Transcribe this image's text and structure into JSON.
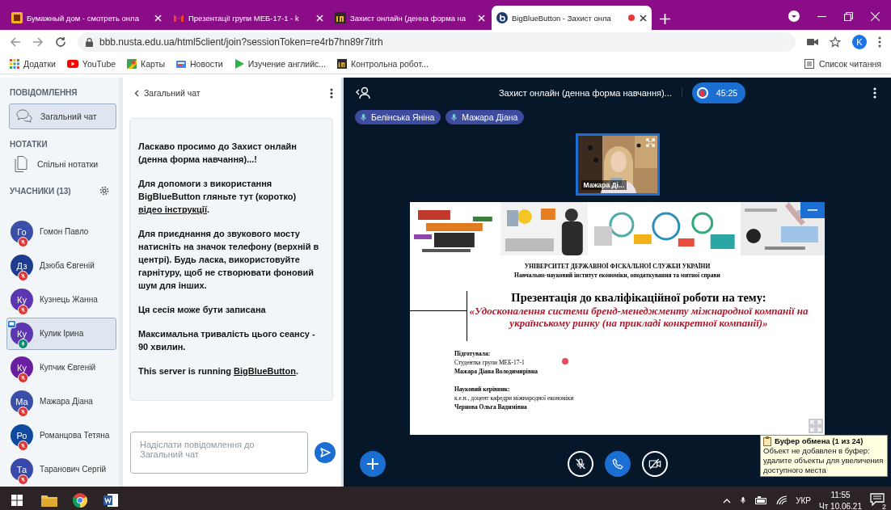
{
  "browser": {
    "tabs": [
      {
        "kind": "book",
        "title": "Бумажный дом - смотреть онла",
        "selected": false,
        "recording": false
      },
      {
        "kind": "mail",
        "title": "Презентації групи МЕБ-17-1 - k",
        "selected": false,
        "recording": false
      },
      {
        "kind": "in",
        "title": "Захист онлайн (денна форма на",
        "selected": false,
        "recording": false
      },
      {
        "kind": "bbb",
        "title": "BigBlueButton - Захист онла",
        "selected": true,
        "recording": true
      }
    ],
    "address": "bbb.nusta.edu.ua/html5client/join?sessionToken=re4rb7hn89r7itrh",
    "profile": "K",
    "bookmarks": [
      {
        "kind": "apps",
        "label": "Додатки"
      },
      {
        "kind": "youtube",
        "label": "YouTube"
      },
      {
        "kind": "maps",
        "label": "Карты"
      },
      {
        "kind": "news",
        "label": "Новости"
      },
      {
        "kind": "play",
        "label": "Изучение английс..."
      },
      {
        "kind": "in",
        "label": "Контрольна робот..."
      }
    ],
    "reading_list": "Список читання"
  },
  "sidebar": {
    "messages_heading": "ПОВІДОМЛЕННЯ",
    "chats": [
      {
        "label": "Загальний чат",
        "selected": true
      }
    ],
    "notes_heading": "НОТАТКИ",
    "notes": [
      {
        "label": "Спільні нотатки"
      }
    ],
    "participants_heading": "УЧАСНИКИ (13)",
    "participants": [
      {
        "initials": "Го",
        "name": "Гомон Павло",
        "color": "#3c4fa8",
        "muted": true,
        "presenter": false,
        "selected": false
      },
      {
        "initials": "Дз",
        "name": "Дзюба Євгеній",
        "color": "#1d3c8f",
        "muted": true,
        "presenter": false,
        "selected": false
      },
      {
        "initials": "Ку",
        "name": "Кузнець Жанна",
        "color": "#5b36b0",
        "muted": true,
        "presenter": false,
        "selected": false
      },
      {
        "initials": "Ку",
        "name": "Кулик Ірина",
        "color": "#5b36b0",
        "muted": false,
        "presenter": true,
        "selected": true
      },
      {
        "initials": "Ку",
        "name": "Купчик Євгеній",
        "color": "#6a1fa0",
        "muted": true,
        "presenter": false,
        "selected": false
      },
      {
        "initials": "Ма",
        "name": "Мажара Діана",
        "color": "#3c4fa8",
        "muted": true,
        "presenter": false,
        "selected": false
      },
      {
        "initials": "Ро",
        "name": "Романцова Тетяна",
        "color": "#0f4a9e",
        "muted": true,
        "presenter": false,
        "selected": false
      },
      {
        "initials": "Та",
        "name": "Таранович Сергій",
        "color": "#3949ab",
        "muted": true,
        "presenter": false,
        "selected": false
      }
    ]
  },
  "chat": {
    "title": "Загальний чат",
    "messages": [
      [
        {
          "kind": "text",
          "text": "Ласкаво просимо до **Захист онлайн (денна форма навчання)...!**"
        }
      ],
      [
        {
          "kind": "text",
          "text": "Для допомоги з використання BigBlueButton гляньте тут (коротко) "
        },
        {
          "kind": "link",
          "text": "відео інструкції"
        },
        {
          "kind": "text",
          "text": "."
        }
      ],
      [
        {
          "kind": "text",
          "text": "Для приєднання до звукового мосту натисніть на значок телефону (верхній в центрі). **Будь ласка, використовуйте гарнітуру, щоб не створювати фоновий шум для інших.**"
        }
      ],
      [
        {
          "kind": "text",
          "text": "Ця сесія може бути записана"
        }
      ],
      [
        {
          "kind": "text",
          "text": "Максимальна тривалість цього сеансу - 90 хвилин."
        }
      ],
      [
        {
          "kind": "text",
          "text": "This server is running "
        },
        {
          "kind": "link",
          "text": "BigBlueButton"
        },
        {
          "kind": "text",
          "text": "."
        }
      ]
    ],
    "input": {
      "placeholder": "Надіслати повідомлення до Загальний чат"
    }
  },
  "meeting": {
    "title": "Захист онлайн (денна форма навчання)...",
    "recording": true,
    "timer": "45:25",
    "talking": [
      {
        "name": "Белінська Яніна"
      },
      {
        "name": "Мажара Діана"
      }
    ],
    "video": {
      "name": "Мажара Ді..."
    },
    "slide": {
      "university": "УНІВЕРСИТЕТ ДЕРЖАВНОЇ ФІСКАЛЬНОЇ СЛУЖБИ УКРАЇНИ",
      "institute": "Навчально-науковий інститут економіки, оподаткування та митної справи",
      "heading": "Презентація до кваліфікаційної роботи на тему:",
      "topic": "«Удосконалення системи бренд-менеджменту міжнародної компанії на українському ринку (на прикладі конкретної компанії)»",
      "credits": [
        [
          {
            "text": "Підготувала:",
            "bold": true
          },
          {
            "text": "Студентка групи МЕБ-17-1",
            "bold": false
          },
          {
            "text": "Мажара Діана Володимирівна",
            "bold": true
          }
        ],
        [
          {
            "text": "Науковий керівник:",
            "bold": true
          },
          {
            "text": "к.е.н., доцент кафедри міжнародної економіки",
            "bold": false
          },
          {
            "text": "Чернова Ольга Вадимівна",
            "bold": true
          }
        ]
      ]
    },
    "controls": {
      "mic_muted": true,
      "audio_joined": true,
      "camera_off": true
    }
  },
  "clipboard": {
    "title": "Буфер обмена (1 из 24)",
    "text": "Объект не добавлен в буфер: удалите объекты для увеличения доступного места"
  },
  "taskbar": {
    "apps": [
      {
        "kind": "explorer"
      },
      {
        "kind": "chrome"
      },
      {
        "kind": "word"
      }
    ],
    "language": "УКР",
    "time": "11:55",
    "date": "Чт 10.06.21",
    "notifications": "2"
  }
}
